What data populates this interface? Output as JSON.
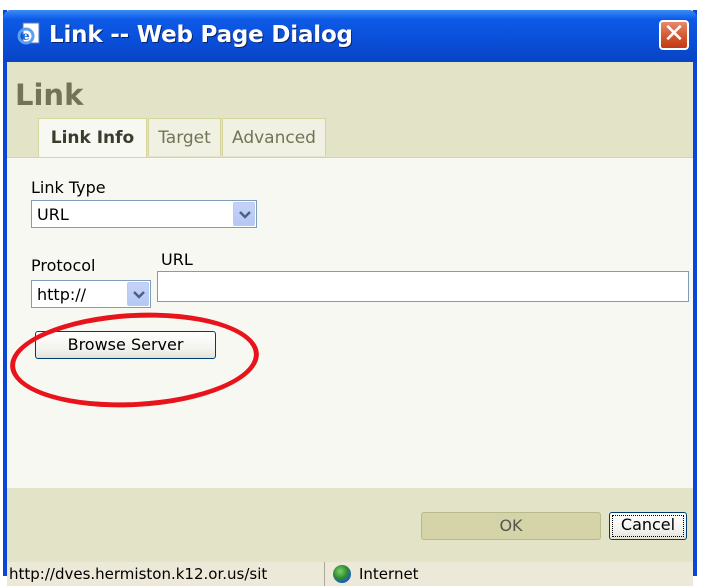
{
  "window": {
    "title": "Link -- Web Page Dialog",
    "close_symbol": "✕",
    "icon": "ie-page-icon"
  },
  "dialog": {
    "title": "Link",
    "tabs": [
      {
        "label": "Link Info",
        "active": true
      },
      {
        "label": "Target",
        "active": false
      },
      {
        "label": "Advanced",
        "active": false
      }
    ]
  },
  "form": {
    "link_type_label": "Link Type",
    "link_type_value": "URL",
    "protocol_label": "Protocol",
    "protocol_value": "http://",
    "url_label": "URL",
    "url_value": "",
    "browse_server_label": "Browse Server"
  },
  "footer": {
    "ok_label": "OK",
    "cancel_label": "Cancel"
  },
  "statusbar": {
    "url_text": "http://dves.hermiston.k12.or.us/sit",
    "zone_text": "Internet",
    "zone_icon": "globe-icon"
  },
  "colors": {
    "titlebar": "#0a4ed8",
    "header_band": "#e3e3c7",
    "panel": "#f8f8f3",
    "annotation": "#e8141c"
  }
}
